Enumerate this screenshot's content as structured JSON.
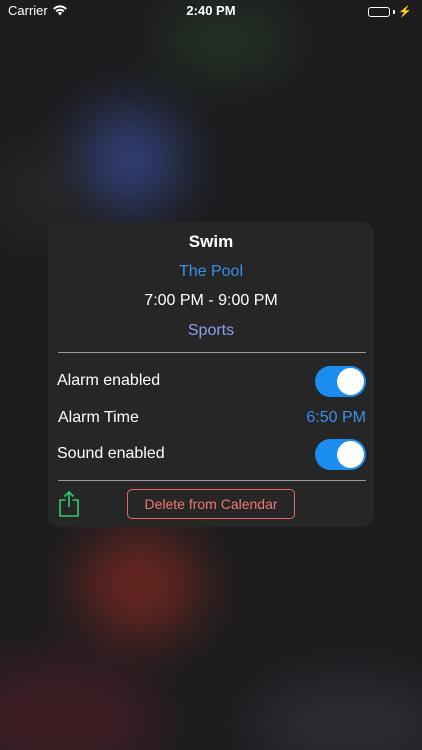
{
  "status_bar": {
    "carrier": "Carrier",
    "time": "2:40 PM",
    "battery_level": 1.0
  },
  "event": {
    "title": "Swim",
    "location": "The Pool",
    "time_range": "7:00 PM - 9:00 PM",
    "category": "Sports"
  },
  "settings": {
    "alarm_enabled_label": "Alarm enabled",
    "alarm_enabled": true,
    "alarm_time_label": "Alarm Time",
    "alarm_time_value": "6:50 PM",
    "sound_enabled_label": "Sound enabled",
    "sound_enabled": true
  },
  "actions": {
    "delete_label": "Delete from Calendar",
    "share_icon": "share-icon"
  },
  "colors": {
    "accent": "#1b8cf0",
    "link": "#3a8fe8",
    "category": "#8aa0e8",
    "danger": "#ee7a6e",
    "share": "#2ecc71"
  }
}
